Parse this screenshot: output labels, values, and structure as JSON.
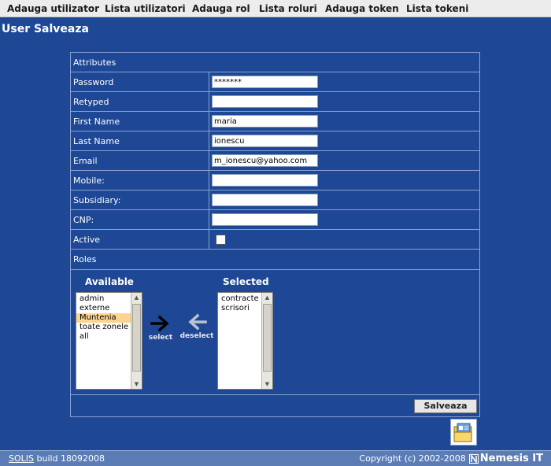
{
  "nav": [
    {
      "label": "Adauga utilizator"
    },
    {
      "label": "Lista utilizatori"
    },
    {
      "label": "Adauga rol"
    },
    {
      "label": "Lista roluri"
    },
    {
      "label": "Adauga token"
    },
    {
      "label": "Lista tokeni"
    }
  ],
  "page_title": "User Salveaza",
  "form": {
    "attributes_header": "Attributes",
    "fields": {
      "password": {
        "label": "Password",
        "value": "*******"
      },
      "retyped": {
        "label": "Retyped",
        "value": ""
      },
      "first_name": {
        "label": "First Name",
        "value": "maria"
      },
      "last_name": {
        "label": "Last Name",
        "value": "ionescu"
      },
      "email": {
        "label": "Email",
        "value": "m_ionescu@yahoo.com"
      },
      "mobile": {
        "label": "Mobile:",
        "value": ""
      },
      "subsidiary": {
        "label": "Subsidiary:",
        "value": ""
      },
      "cnp": {
        "label": "CNP:",
        "value": ""
      },
      "active": {
        "label": "Active",
        "checked": false
      }
    },
    "roles_header": "Roles",
    "available_header": "Available",
    "selected_header": "Selected",
    "available_options": [
      "admin",
      "externe",
      "Muntenia",
      "toate zonele",
      "all"
    ],
    "available_highlighted": "Muntenia",
    "selected_options": [
      "contracte",
      "scrisori"
    ],
    "select_label": "select",
    "deselect_label": "deselect",
    "save_label": "Salveaza"
  },
  "footer": {
    "app_name": "SOLIS",
    "build": " build 18092008",
    "copyright": "Copyright (c) 2002-2008",
    "brand": "Nemesis IT"
  },
  "colors": {
    "background": "#1e4796",
    "highlight": "#fbd491",
    "footer": "#5c7cb6"
  }
}
